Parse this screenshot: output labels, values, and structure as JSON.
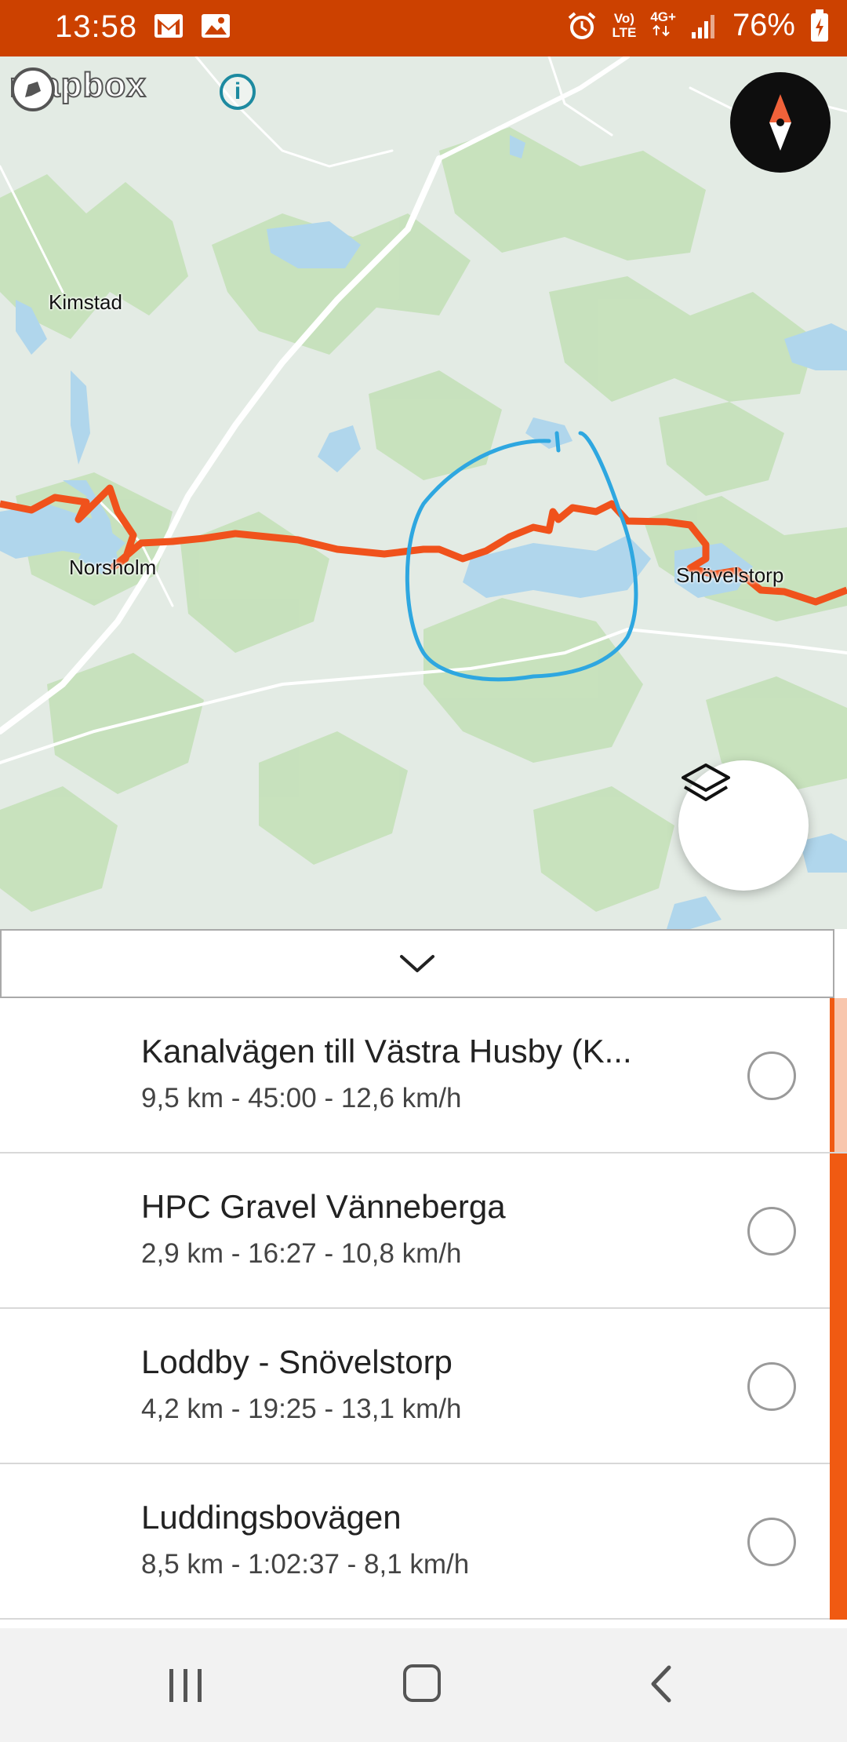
{
  "status_bar": {
    "time": "13:58",
    "network_top": "Vo)",
    "network_bottom": "LTE",
    "data_type": "4G+",
    "battery": "76%"
  },
  "map": {
    "attribution_logo": "mapbox",
    "info_label": "i",
    "places": {
      "kimstad": "Kimstad",
      "norsholm": "Norsholm",
      "snovelstorp": "Snövelstorp"
    },
    "colors": {
      "route": "#f0521c",
      "annotation": "#2ea7e0",
      "water": "#b0d6ec",
      "forest": "#c6e1bb",
      "land": "#e3ebe4"
    }
  },
  "controls": {
    "compass_icon": "compass-icon",
    "layers_icon": "layers-icon",
    "collapse_icon": "chevron-down-icon"
  },
  "segments": [
    {
      "name": "Kanalvägen till Västra Husby (K...",
      "stats": "9,5 km - 45:00 - 12,6 km/h"
    },
    {
      "name": "HPC Gravel Vänneberga",
      "stats": "2,9 km - 16:27 - 10,8 km/h"
    },
    {
      "name": "Loddby - Snövelstorp",
      "stats": "4,2 km - 19:25 - 13,1 km/h"
    },
    {
      "name": "Luddingsbovägen",
      "stats": "8,5 km - 1:02:37 - 8,1 km/h"
    }
  ]
}
